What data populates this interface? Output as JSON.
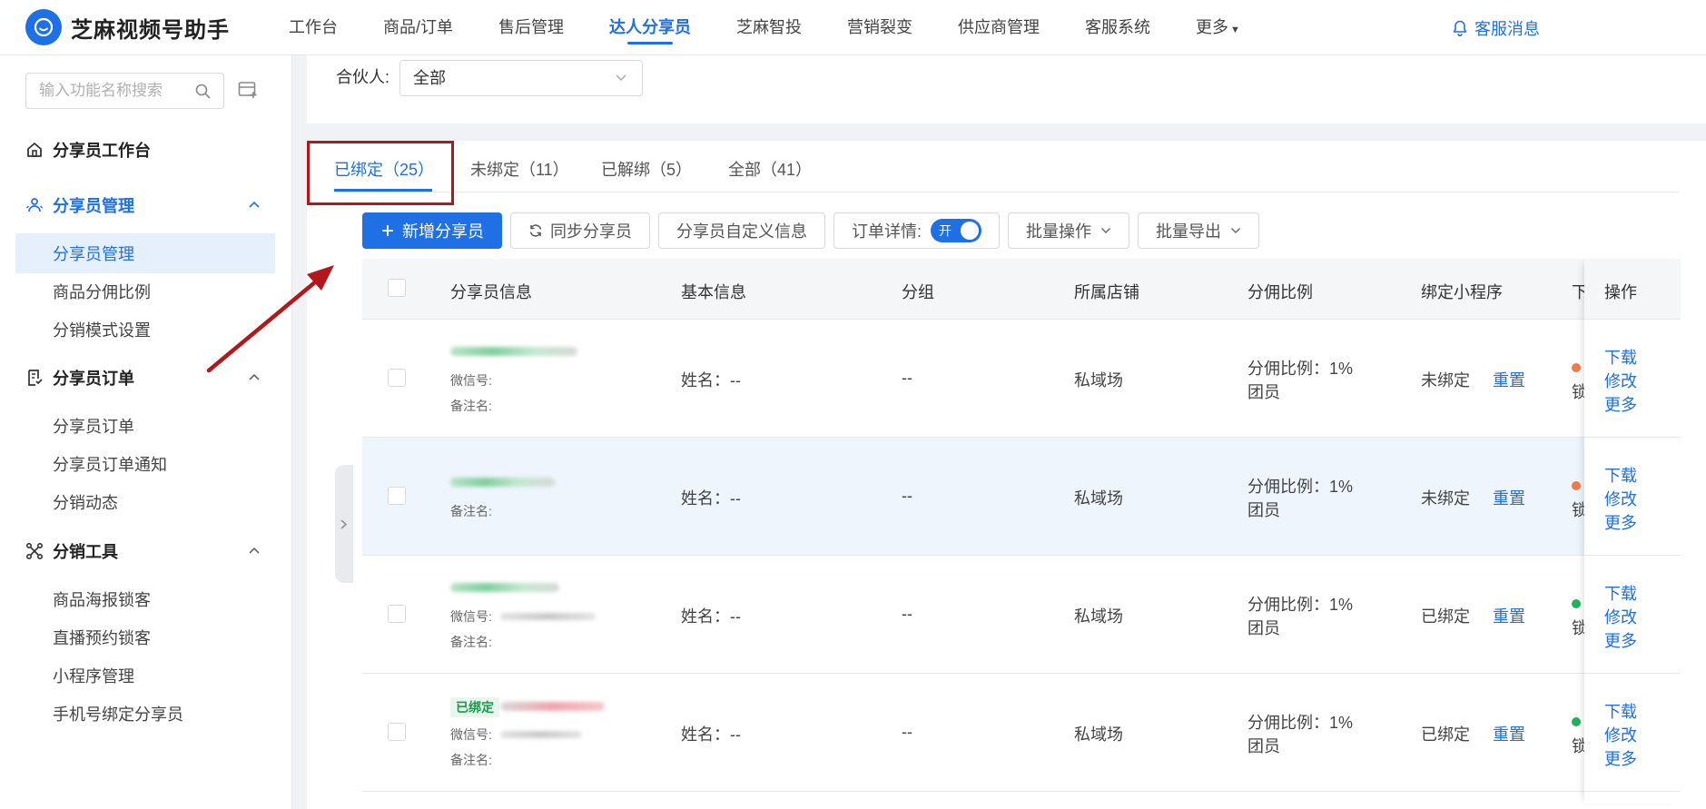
{
  "app": {
    "title": "芝麻视频号助手",
    "logo_icon": "chat-bubble-icon",
    "brand_color": "#1f6fe5"
  },
  "nav": {
    "items": [
      "工作台",
      "商品/订单",
      "售后管理",
      "达人分享员",
      "芝麻智投",
      "营销裂变",
      "供应商管理",
      "客服系统",
      "更多"
    ],
    "active": "达人分享员",
    "service_message": "客服消息"
  },
  "sidebar": {
    "search_placeholder": "输入功能名称搜索",
    "workbench": "分享员工作台",
    "groups": [
      {
        "label": "分享员管理",
        "items": [
          "分享员管理",
          "商品分佣比例",
          "分销模式设置"
        ]
      },
      {
        "label": "分享员订单",
        "items": [
          "分享员订单",
          "分享员订单通知",
          "分销动态"
        ]
      },
      {
        "label": "分销工具",
        "items": [
          "商品海报锁客",
          "直播预约锁客",
          "小程序管理",
          "手机号绑定分享员"
        ]
      }
    ]
  },
  "filter": {
    "partner_label": "合伙人:",
    "partner_value": "全部"
  },
  "tabs": [
    {
      "label": "已绑定（25）",
      "active": true
    },
    {
      "label": "未绑定（11）"
    },
    {
      "label": "已解绑（5）"
    },
    {
      "label": "全部（41）"
    }
  ],
  "toolbar": {
    "add": "新增分享员",
    "sync": "同步分享员",
    "custom": "分享员自定义信息",
    "order_detail_label": "订单详情:",
    "order_detail_toggle": "开",
    "batch_ops": "批量操作",
    "batch_export": "批量导出"
  },
  "table": {
    "headers": [
      "分享员信息",
      "基本信息",
      "分组",
      "所属店铺",
      "分佣比例",
      "绑定小程序",
      "下",
      "操作"
    ],
    "rows": [
      {
        "wechat_label": "微信号:",
        "remark_label": "备注名:",
        "name": "姓名：--",
        "group": "--",
        "shop": "私域场",
        "ratio": "分佣比例：1%",
        "ratio_sub": "团员",
        "mini_status": "未绑定",
        "reset": "重置",
        "lock": "锁",
        "dot_color": "#f07c4a",
        "ops": [
          "下载",
          "修改",
          "更多"
        ]
      },
      {
        "wechat_label": "",
        "remark_label": "备注名:",
        "name": "姓名：--",
        "group": "--",
        "shop": "私域场",
        "ratio": "分佣比例：1%",
        "ratio_sub": "团员",
        "mini_status": "未绑定",
        "reset": "重置",
        "lock": "锁",
        "dot_color": "#f07c4a",
        "ops": [
          "下载",
          "修改",
          "更多"
        ]
      },
      {
        "wechat_label": "微信号:",
        "remark_label": "备注名:",
        "name": "姓名：--",
        "group": "--",
        "shop": "私域场",
        "ratio": "分佣比例：1%",
        "ratio_sub": "团员",
        "mini_status": "已绑定",
        "reset": "重置",
        "lock": "锁",
        "dot_color": "#22b25a",
        "ops": [
          "下载",
          "修改",
          "更多"
        ]
      },
      {
        "tag": "已绑定",
        "wechat_label": "微信号:",
        "remark_label": "备注名:",
        "name": "姓名：--",
        "group": "--",
        "shop": "私域场",
        "ratio": "分佣比例：1%",
        "ratio_sub": "团员",
        "mini_status": "已绑定",
        "reset": "重置",
        "lock": "锁",
        "dot_color": "#22b25a",
        "ops": [
          "下载",
          "修改",
          "更多"
        ]
      }
    ]
  }
}
